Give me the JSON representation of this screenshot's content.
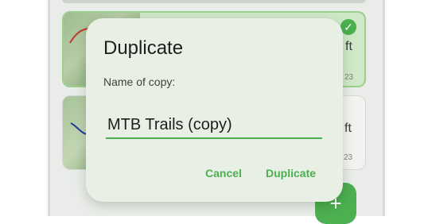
{
  "background": {
    "card1": {
      "unit": "ft",
      "date_suffix": "23"
    },
    "card2": {
      "unit": "ft",
      "date_suffix": "23"
    },
    "fab_icon": "plus-icon"
  },
  "dialog": {
    "title": "Duplicate",
    "field_label": "Name of copy:",
    "input_value": "MTB Trails (copy)",
    "cancel_label": "Cancel",
    "confirm_label": "Duplicate"
  },
  "colors": {
    "accent": "#4caf50",
    "dialog_bg": "#e8f0e6",
    "selected_card": "#cfe9c8"
  }
}
